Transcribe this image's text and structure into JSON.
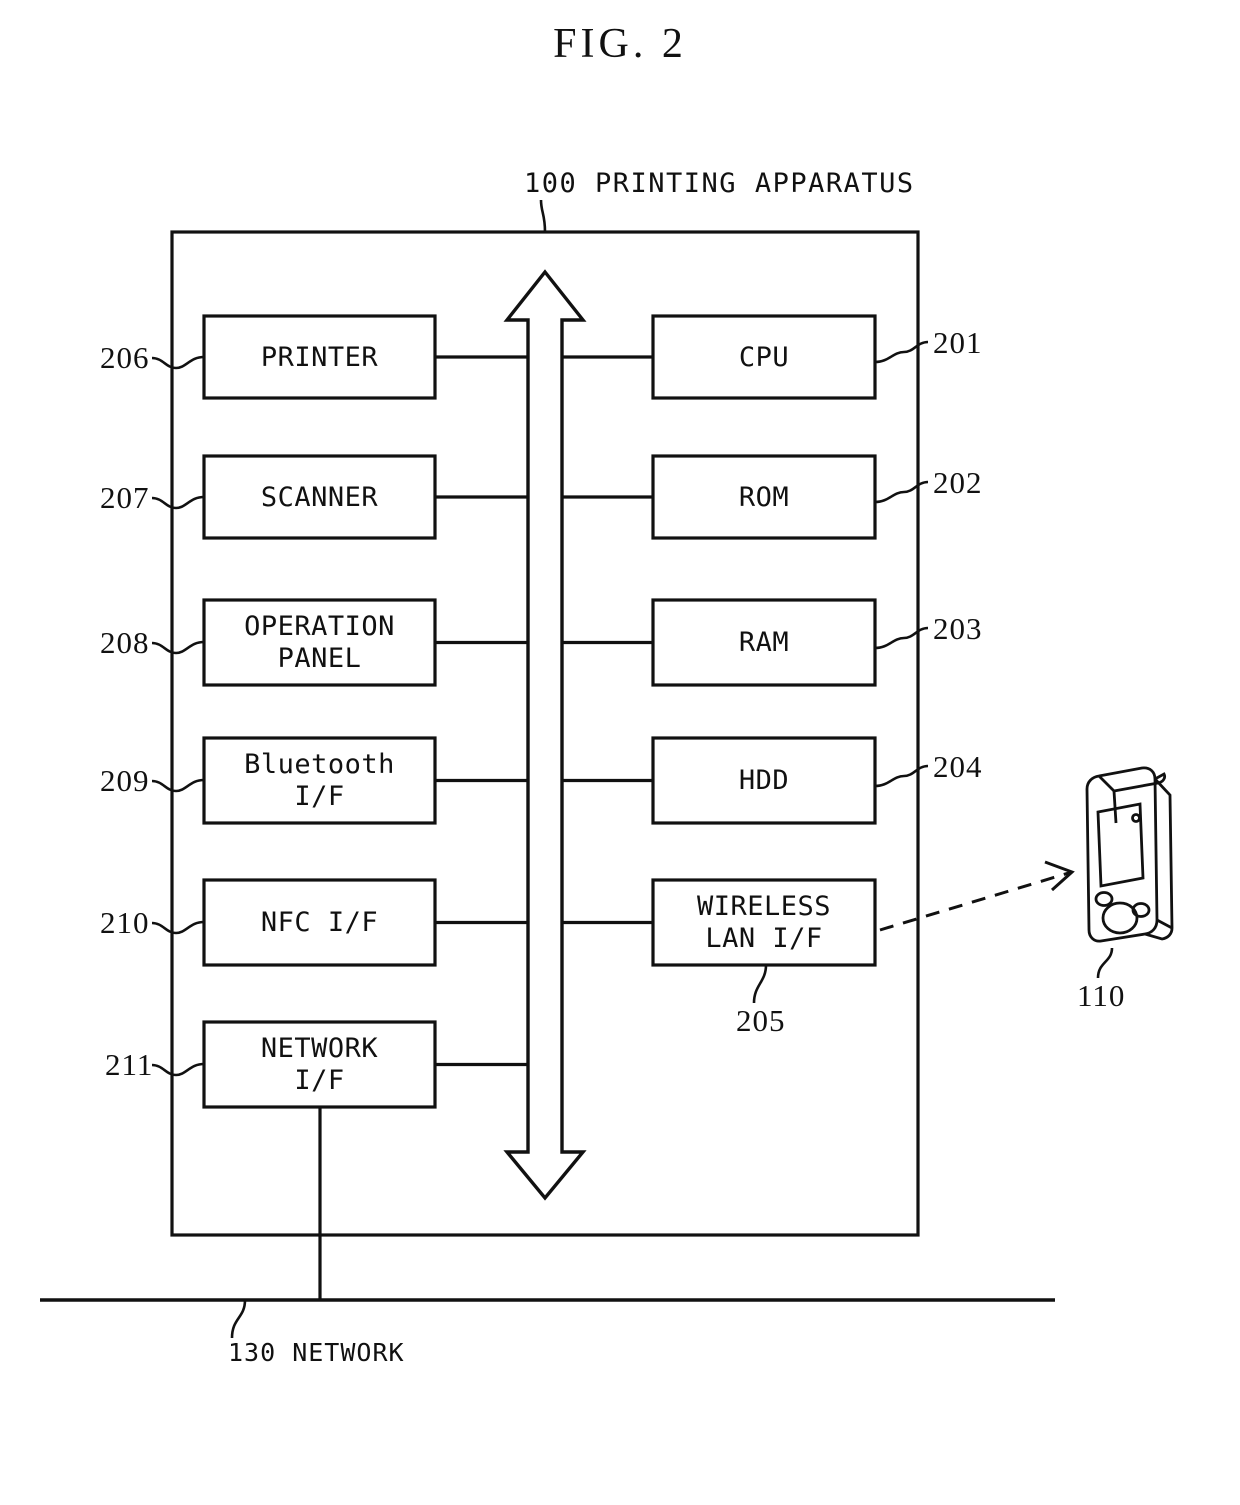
{
  "figure": {
    "title": "FIG. 2",
    "apparatus_label": "100 PRINTING APPARATUS",
    "network_label": "130 NETWORK",
    "device_ref": "110",
    "wireless_ref": "205",
    "line_color": "#111111",
    "background": "#ffffff"
  },
  "left_column": [
    {
      "ref": "206",
      "label": "PRINTER",
      "lines": [
        "PRINTER"
      ]
    },
    {
      "ref": "207",
      "label": "SCANNER",
      "lines": [
        "SCANNER"
      ]
    },
    {
      "ref": "208",
      "label": "OPERATION PANEL",
      "lines": [
        "OPERATION",
        "PANEL"
      ]
    },
    {
      "ref": "209",
      "label": "Bluetooth I/F",
      "lines": [
        "Bluetooth",
        "I/F"
      ]
    },
    {
      "ref": "210",
      "label": "NFC I/F",
      "lines": [
        "NFC I/F"
      ]
    },
    {
      "ref": "211",
      "label": "NETWORK I/F",
      "lines": [
        "NETWORK",
        "I/F"
      ]
    }
  ],
  "right_column": [
    {
      "ref": "201",
      "label": "CPU",
      "lines": [
        "CPU"
      ]
    },
    {
      "ref": "202",
      "label": "ROM",
      "lines": [
        "ROM"
      ]
    },
    {
      "ref": "203",
      "label": "RAM",
      "lines": [
        "RAM"
      ]
    },
    {
      "ref": "204",
      "label": "HDD",
      "lines": [
        "HDD"
      ]
    },
    {
      "ref": "205",
      "label": "WIRELESS LAN I/F",
      "lines": [
        "WIRELESS",
        "LAN I/F"
      ]
    }
  ],
  "boxes": {
    "printer": {
      "l1": "PRINTER"
    },
    "scanner": {
      "l1": "SCANNER"
    },
    "operation": {
      "l1": "OPERATION",
      "l2": "PANEL"
    },
    "bluetooth": {
      "l1": "Bluetooth",
      "l2": "I/F"
    },
    "nfc": {
      "l1": "NFC I/F"
    },
    "network_if": {
      "l1": "NETWORK",
      "l2": "I/F"
    },
    "cpu": {
      "l1": "CPU"
    },
    "rom": {
      "l1": "ROM"
    },
    "ram": {
      "l1": "RAM"
    },
    "hdd": {
      "l1": "HDD"
    },
    "wireless": {
      "l1": "WIRELESS",
      "l2": "LAN I/F"
    }
  },
  "refs": {
    "r206": "206",
    "r207": "207",
    "r208": "208",
    "r209": "209",
    "r210": "210",
    "r211": "211",
    "r201": "201",
    "r202": "202",
    "r203": "203",
    "r204": "204",
    "r205": "205",
    "r110": "110"
  },
  "bus": {
    "name": "system bus",
    "orientation": "vertical",
    "double_headed": true
  }
}
